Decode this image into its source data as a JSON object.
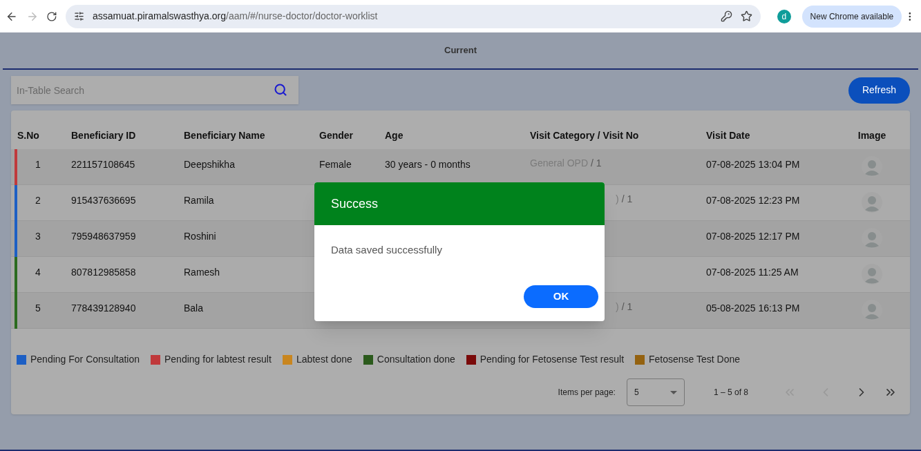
{
  "browser": {
    "url_host": "assamuat.piramalswasthya.org",
    "url_path": "/aam/#/nurse-doctor/doctor-worklist",
    "profile_initial": "d",
    "update_label": "New Chrome available"
  },
  "tabs": [
    {
      "label": "Current",
      "selected": true
    }
  ],
  "search": {
    "placeholder": "In-Table Search"
  },
  "refresh_button": "Refresh",
  "table": {
    "columns": [
      "S.No",
      "Beneficiary ID",
      "Beneficiary Name",
      "Gender",
      "Age",
      "Visit Category / Visit No",
      "Visit Date",
      "Image"
    ],
    "rows": [
      {
        "sno": "1",
        "id": "221157108645",
        "name": "Deepshikha",
        "gender": "Female",
        "age": "30 years - 0 months",
        "visit_category": "General OPD",
        "visit_no": "/ 1",
        "date": "07-08-2025 13:04 PM",
        "color": "#c0393b"
      },
      {
        "sno": "2",
        "id": "915437636695",
        "name": "Ramila",
        "visit_category": ")",
        "visit_no": "/ 1",
        "date": "07-08-2025 12:23 PM",
        "color": "#1d5fc4"
      },
      {
        "sno": "3",
        "id": "795948637959",
        "name": "Roshini",
        "date": "07-08-2025 12:17 PM",
        "color": "#1d5fc4"
      },
      {
        "sno": "4",
        "id": "807812985858",
        "name": "Ramesh",
        "date": "07-08-2025 11:25 AM",
        "color": "#2b6b1f"
      },
      {
        "sno": "5",
        "id": "778439128940",
        "name": "Bala",
        "visit_category": ")",
        "visit_no": "/ 1",
        "date": "05-08-2025 16:13 PM",
        "color": "#2b6b1f"
      }
    ]
  },
  "legend": [
    {
      "label": "Pending For Consultation",
      "color": "#1d5fc4"
    },
    {
      "label": "Pending for labtest result",
      "color": "#c0393b"
    },
    {
      "label": "Labtest done",
      "color": "#c9861f"
    },
    {
      "label": "Consultation done",
      "color": "#2b5a1c"
    },
    {
      "label": "Pending for Fetosense Test result",
      "color": "#7a0a0a"
    },
    {
      "label": "Fetosense Test Done",
      "color": "#946210"
    }
  ],
  "paginator": {
    "label": "Items per page:",
    "page_size": "5",
    "range": "1 – 5 of 8"
  },
  "dialog": {
    "title": "Success",
    "message": "Data saved successfully",
    "ok": "OK"
  }
}
